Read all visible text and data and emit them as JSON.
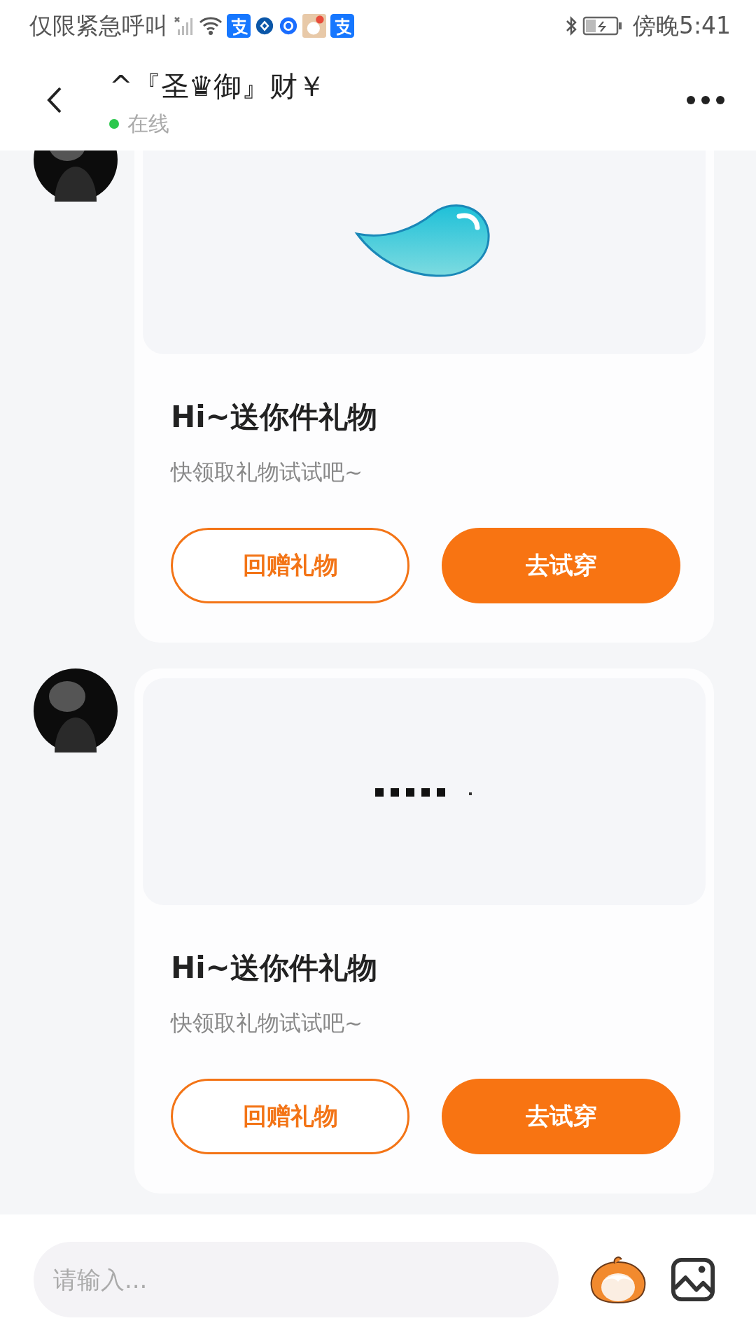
{
  "status_bar": {
    "notice": "仅限紧急呼叫",
    "time": "傍晚5:41"
  },
  "header": {
    "title": "^『圣♛御』财￥",
    "online": true,
    "status": "在线"
  },
  "messages": [
    {
      "kind": "drop",
      "title": "Hi~送你件礼物",
      "subtitle": "快领取礼物试试吧~",
      "buttons": [
        {
          "label": "回赠礼物",
          "kind": "outline"
        },
        {
          "label": "去试穿",
          "kind": "filled"
        }
      ]
    },
    {
      "kind": "loading",
      "title": "Hi~送你件礼物",
      "subtitle": "快领取礼物试试吧~",
      "buttons": [
        {
          "label": "回赠礼物",
          "kind": "outline"
        },
        {
          "label": "去试穿",
          "kind": "filled"
        }
      ]
    }
  ],
  "composer": {
    "placeholder": "请输入..."
  }
}
